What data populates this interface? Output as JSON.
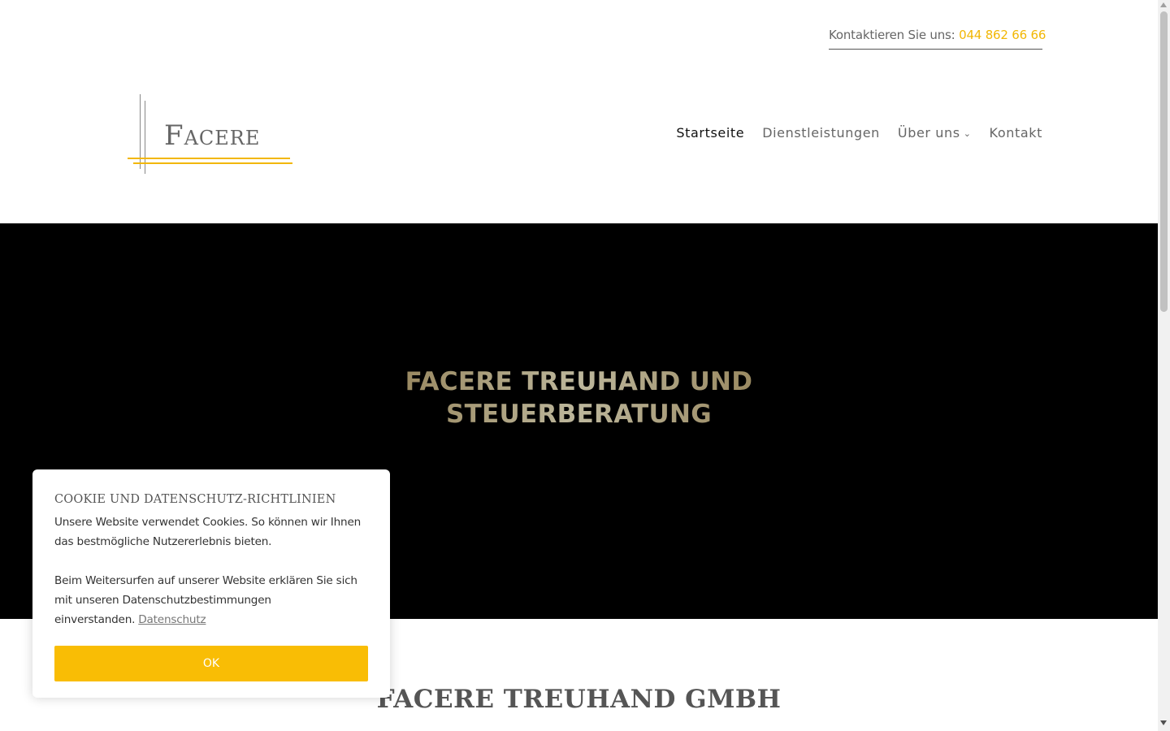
{
  "topbar": {
    "contact_label": "Kontaktieren Sie uns:",
    "phone": "044 862 66 66"
  },
  "logo": {
    "text": "Facere"
  },
  "nav": {
    "items": [
      {
        "label": "Startseite",
        "active": true
      },
      {
        "label": "Dienstleistungen",
        "active": false
      },
      {
        "label": "Über uns",
        "active": false,
        "has_dropdown": true
      },
      {
        "label": "Kontakt",
        "active": false
      }
    ],
    "dropdown_icon": "chevron-down-icon"
  },
  "hero": {
    "title_line1": "FACERE TREUHAND UND",
    "title_line2": "STEUERBERATUNG"
  },
  "section": {
    "title": "FACERE TREUHAND GMBH"
  },
  "cookie": {
    "title": "COOKIE UND DATENSCHUTZ-RICHTLINIEN",
    "text1": "Unsere Website verwendet Cookies. So können wir Ihnen das bestmögliche Nutzererlebnis bieten.",
    "text2": "Beim Weitersurfen auf unserer Website erklären Sie sich mit unseren Datenschutzbestimmungen einverstanden.",
    "link": "Datenschutz",
    "ok_label": "OK"
  },
  "colors": {
    "accent": "#f9bd05",
    "hero_bg": "#000000",
    "text": "#666666"
  }
}
